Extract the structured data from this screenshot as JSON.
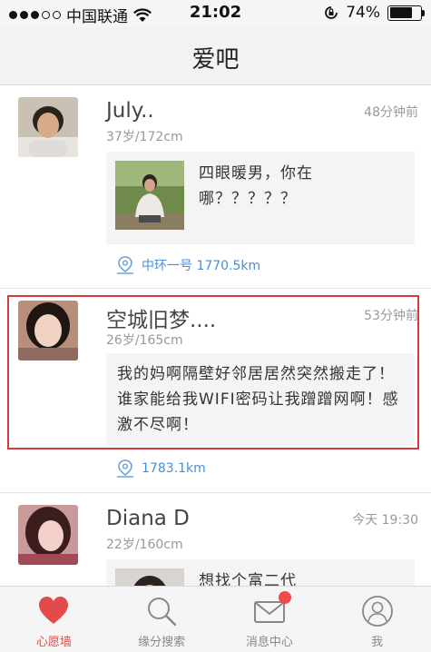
{
  "status_bar": {
    "carrier": "中国联通",
    "time": "21:02",
    "battery": "74%",
    "battery_level": 0.74
  },
  "nav": {
    "title": "爱吧"
  },
  "posts": [
    {
      "name": "July..",
      "time": "48分钟前",
      "meta": "37岁/172cm",
      "text": "四眼暖男，你在哪？？？？？",
      "has_image": true,
      "location": "中环一号 1770.5km"
    },
    {
      "name": "空城旧梦....",
      "time": "53分钟前",
      "meta": "26岁/165cm",
      "text": "我的妈啊隔壁好邻居居然突然搬走了！谁家能给我WIFI密码让我蹭蹭网啊！感激不尽啊！",
      "has_image": false,
      "location": "1783.1km"
    },
    {
      "name": "Diana D",
      "time": "今天 19:30",
      "meta": "22岁/160cm",
      "text": "想找个富二代",
      "has_image": true,
      "location": ""
    }
  ],
  "tabs": [
    {
      "label": "心愿墙",
      "icon": "heart-icon",
      "active": true
    },
    {
      "label": "缘分搜索",
      "icon": "search-icon",
      "active": false
    },
    {
      "label": "消息中心",
      "icon": "mail-icon",
      "active": false,
      "badge": true
    },
    {
      "label": "我",
      "icon": "profile-icon",
      "active": false
    }
  ],
  "colors": {
    "accent": "#e34a4a",
    "link": "#4a8ed6",
    "highlight_border": "#d63a3a"
  }
}
